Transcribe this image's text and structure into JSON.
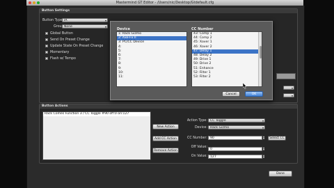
{
  "window": {
    "title": "Mastermind GT Editor - /Users/nic/Desktop/Gtdefault.cfg"
  },
  "general": {
    "section_title": "Button Settings",
    "button_type_label": "Button Type:",
    "button_type_value": "IA",
    "group_label": "Group:",
    "group_value": "None",
    "checkboxes": [
      {
        "label": "Global Button",
        "checked": false
      },
      {
        "label": "Send On Preset Change",
        "checked": false
      },
      {
        "label": "Update State On Preset Change",
        "checked": false
      },
      {
        "label": "Momentary",
        "checked": false
      },
      {
        "label": "Flash w/ Tempo",
        "checked": false
      }
    ]
  },
  "actions": {
    "section_title": "Button Actions",
    "list": [
      "Rack Comes Function 3 / CC Toggle #90 off:0 on:127"
    ],
    "new_action": "New Action",
    "add_cc_action": "Add CC Action",
    "remove_action": "Remove Action",
    "action_type_label": "Action Type:",
    "action_type_value": "CC Toggle",
    "device_label": "Device:",
    "device_value": "Rack Gizmo",
    "cc_number_label": "CC Number:",
    "cc_number_value": "90",
    "select_cc": "Select CC",
    "off_value_label": "Off Value:",
    "off_value_value": "0",
    "on_value_label": "On Value:",
    "on_value_value": "127",
    "done": "Done"
  },
  "dialog": {
    "device_header": "Device",
    "cc_header": "CC Number",
    "devices": [
      {
        "label": "1: Rack Gizmo",
        "state": "alt"
      },
      {
        "label": "2: Axe-Fx II",
        "state": "sel"
      },
      {
        "label": "3: PC/CC Device",
        "state": ""
      },
      {
        "label": "4:",
        "state": ""
      },
      {
        "label": "5:",
        "state": ""
      },
      {
        "label": "6:",
        "state": ""
      },
      {
        "label": "7:",
        "state": ""
      },
      {
        "label": "8:",
        "state": ""
      },
      {
        "label": "9:",
        "state": ""
      },
      {
        "label": "10:",
        "state": ""
      },
      {
        "label": "11:",
        "state": ""
      }
    ],
    "cc_numbers": [
      {
        "label": "43: Comp 1",
        "state": ""
      },
      {
        "label": "44: Comp 2",
        "state": ""
      },
      {
        "label": "45: Xover 1",
        "state": ""
      },
      {
        "label": "46: Xover 2",
        "state": ""
      },
      {
        "label": "47: Delay 1",
        "state": "sel"
      },
      {
        "label": "48: Delay 2",
        "state": ""
      },
      {
        "label": "49: Drive 1",
        "state": ""
      },
      {
        "label": "50: Drive 2",
        "state": ""
      },
      {
        "label": "51: Enhance",
        "state": ""
      },
      {
        "label": "52: Filter 1",
        "state": ""
      },
      {
        "label": "53: Filter 2",
        "state": ""
      }
    ],
    "cancel": "Cancel",
    "ok": "OK"
  },
  "colors": {
    "selection": "#3b73c6",
    "window_bg": "#2b2b2b"
  }
}
